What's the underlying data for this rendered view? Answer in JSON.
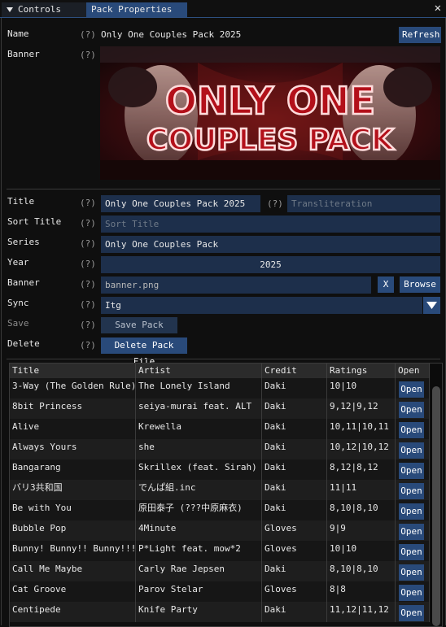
{
  "tabs": {
    "controls": "Controls",
    "pack": "Pack Properties"
  },
  "help": "(?)",
  "name": {
    "label": "Name",
    "value": "Only One Couples Pack 2025",
    "refresh": "Refresh"
  },
  "banner_img": {
    "label": "Banner",
    "line1": "ONLY ONE",
    "line2": "COUPLES PACK"
  },
  "form": {
    "title_label": "Title",
    "title_value": "Only One Couples Pack 2025",
    "translit_placeholder": "Transliteration",
    "sort_label": "Sort Title",
    "sort_placeholder": "Sort Title",
    "series_label": "Series",
    "series_value": "Only One Couples Pack",
    "year_label": "Year",
    "year_value": "2025",
    "banner_label": "Banner",
    "banner_value": "banner.png",
    "banner_clear": "X",
    "banner_browse": "Browse",
    "sync_label": "Sync",
    "sync_value": "Itg",
    "save_label": "Save",
    "save_button": "Save Pack File",
    "delete_label": "Delete",
    "delete_button": "Delete Pack File"
  },
  "table": {
    "headers": [
      "Title",
      "Artist",
      "Credit",
      "Ratings",
      "Open"
    ],
    "open_label": "Open",
    "rows": [
      {
        "title": "3-Way (The Golden Rule)",
        "artist": "The Lonely Island",
        "credit": "Daki",
        "ratings": "10|10"
      },
      {
        "title": "8bit Princess",
        "artist": "seiya-murai feat. ALT",
        "credit": "Daki",
        "ratings": "9,12|9,12"
      },
      {
        "title": "Alive",
        "artist": "Krewella",
        "credit": "Daki",
        "ratings": "10,11|10,11"
      },
      {
        "title": "Always Yours",
        "artist": "she",
        "credit": "Daki",
        "ratings": "10,12|10,12"
      },
      {
        "title": "Bangarang",
        "artist": "Skrillex (feat. Sirah)",
        "credit": "Daki",
        "ratings": "8,12|8,12"
      },
      {
        "title": "バリ3共和国",
        "artist": "でんぱ組.inc",
        "credit": "Daki",
        "ratings": "11|11"
      },
      {
        "title": "Be with You",
        "artist": "原田泰子 (???中原麻衣)",
        "credit": "Daki",
        "ratings": "8,10|8,10"
      },
      {
        "title": "Bubble Pop",
        "artist": "4Minute",
        "credit": "Gloves",
        "ratings": "9|9"
      },
      {
        "title": "Bunny! Bunny!! Bunny!!!",
        "artist": "P*Light feat. mow*2",
        "credit": "Gloves",
        "ratings": "10|10"
      },
      {
        "title": "Call Me Maybe",
        "artist": "Carly Rae Jepsen",
        "credit": "Daki",
        "ratings": "8,10|8,10"
      },
      {
        "title": "Cat Groove",
        "artist": "Parov Stelar",
        "credit": "Gloves",
        "ratings": "8|8"
      },
      {
        "title": "Centipede",
        "artist": "Knife Party",
        "credit": "Daki",
        "ratings": "11,12|11,12"
      }
    ]
  }
}
